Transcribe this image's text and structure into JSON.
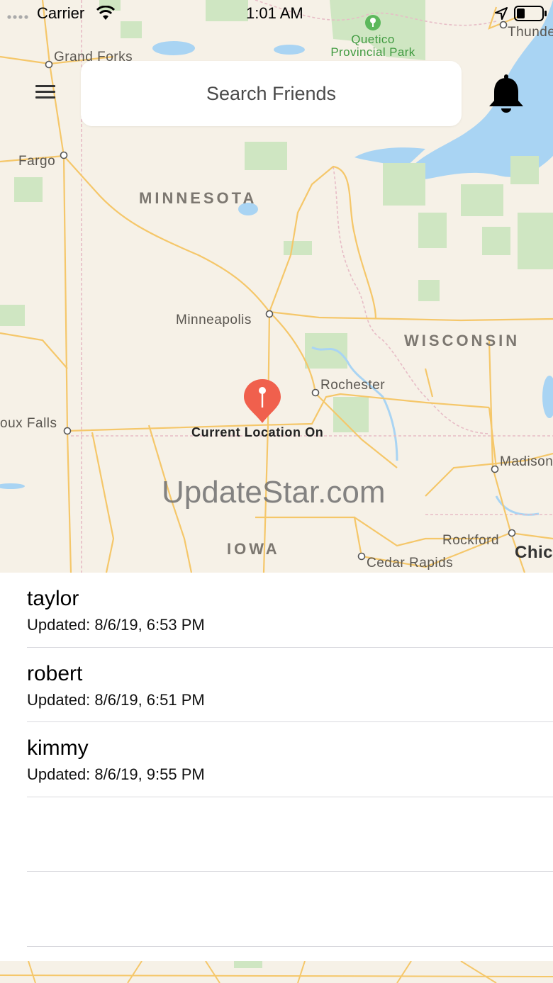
{
  "status_bar": {
    "carrier": "Carrier",
    "time": "1:01 AM"
  },
  "map": {
    "labels": {
      "grand_forks": "Grand Forks",
      "fargo": "Fargo",
      "minnesota": "MINNESOTA",
      "minneapolis": "Minneapolis",
      "wisconsin": "WISCONSIN",
      "rochester": "Rochester",
      "sioux_falls": "oux Falls",
      "madison": "Madison",
      "rockford": "Rockford",
      "chicago": "Chic",
      "cedar_rapids": "Cedar Rapids",
      "iowa": "IOWA",
      "thunder": "Thunde",
      "park": "Quetico\nProvincial Park"
    },
    "pin_label": "Current Location On",
    "watermark": "UpdateStar.com"
  },
  "search": {
    "placeholder": "Search Friends"
  },
  "friends": [
    {
      "name": "taylor",
      "updated": "Updated: 8/6/19, 6:53 PM"
    },
    {
      "name": "robert",
      "updated": "Updated: 8/6/19, 6:51 PM"
    },
    {
      "name": "kimmy",
      "updated": "Updated: 8/6/19, 9:55 PM"
    }
  ],
  "icons": {
    "menu": "hamburger-menu-icon",
    "bell": "bell-icon",
    "pin": "location-pin-icon"
  },
  "colors": {
    "pin": "#f0604d",
    "water": "#a9d4f3",
    "park": "#cfe6c2",
    "land": "#f6f1e7",
    "road": "#f5c76a"
  }
}
